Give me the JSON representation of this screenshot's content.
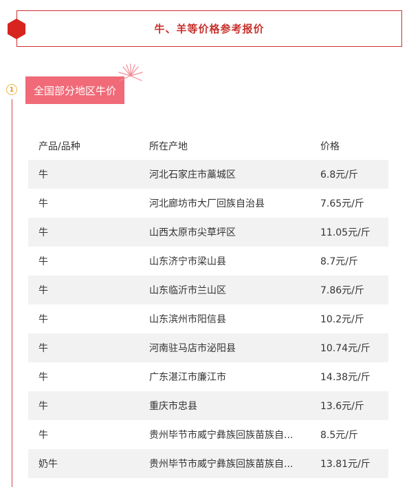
{
  "header": {
    "title": "牛、羊等价格参考报价"
  },
  "section": {
    "number": "1",
    "title": "全国部分地区牛价"
  },
  "table": {
    "columns": [
      "产品/品种",
      "所在产地",
      "价格"
    ],
    "rows": [
      [
        "牛",
        "河北石家庄市藁城区",
        "6.8元/斤"
      ],
      [
        "牛",
        "河北廊坊市大厂回族自治县",
        "7.65元/斤"
      ],
      [
        "牛",
        "山西太原市尖草坪区",
        "11.05元/斤"
      ],
      [
        "牛",
        "山东济宁市梁山县",
        "8.7元/斤"
      ],
      [
        "牛",
        "山东临沂市兰山区",
        "7.86元/斤"
      ],
      [
        "牛",
        "山东滨州市阳信县",
        "10.2元/斤"
      ],
      [
        "牛",
        "河南驻马店市泌阳县",
        "10.74元/斤"
      ],
      [
        "牛",
        "广东湛江市廉江市",
        "14.38元/斤"
      ],
      [
        "牛",
        "重庆市忠县",
        "13.6元/斤"
      ],
      [
        "牛",
        "贵州毕节市威宁彝族回族苗族自...",
        "8.5元/斤"
      ],
      [
        "奶牛",
        "贵州毕节市威宁彝族回族苗族自...",
        "13.81元/斤"
      ]
    ]
  },
  "colors": {
    "accent_red": "#c9302c",
    "tag_pink": "#f06a78",
    "number_gold": "#e0a030",
    "row_shade": "#f2f2f2"
  },
  "icons": {
    "title_marker": "hexagon-icon",
    "decoration": "firework-burst-icon"
  }
}
